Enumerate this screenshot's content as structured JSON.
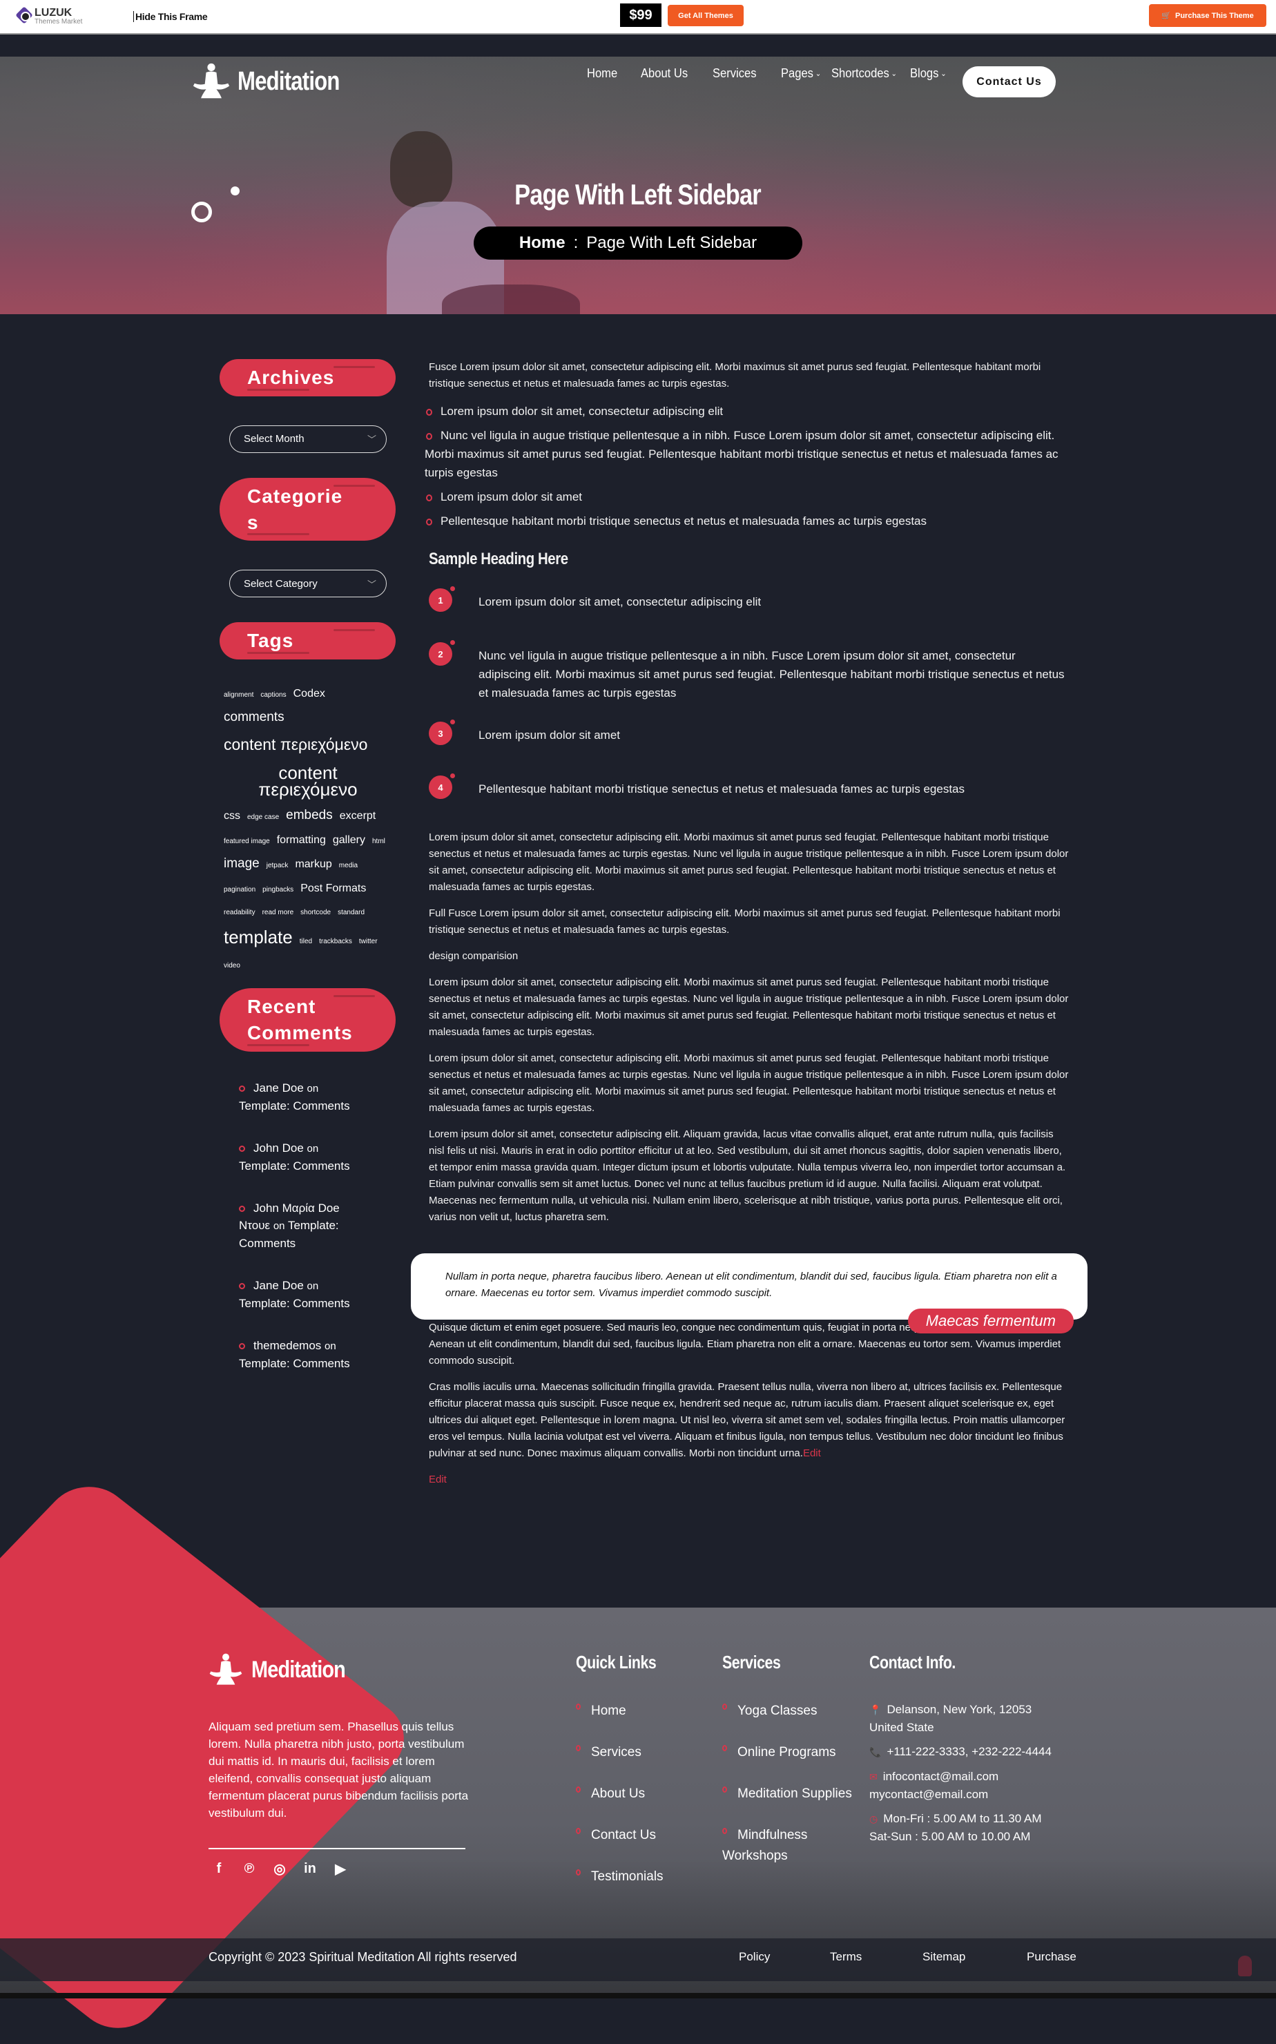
{
  "frame": {
    "brand": "LUZUK",
    "brand_sub": "Themes Market",
    "hide_frame": "Hide This Frame",
    "price": "$99",
    "get_all_themes": "Get All Themes",
    "purchase_theme": "Purchase This Theme"
  },
  "header": {
    "logo_text": "Meditation",
    "nav": [
      {
        "label": "Home",
        "dropdown": false
      },
      {
        "label": "About Us",
        "dropdown": false
      },
      {
        "label": "Services",
        "dropdown": false
      },
      {
        "label": "Pages",
        "dropdown": true
      },
      {
        "label": "Shortcodes",
        "dropdown": true
      },
      {
        "label": "Blogs",
        "dropdown": true
      }
    ],
    "contact_button": "Contact Us"
  },
  "hero": {
    "title": "Page With Left Sidebar",
    "breadcrumb": {
      "home": "Home",
      "separator": ":",
      "current": "Page With Left Sidebar"
    }
  },
  "sidebar": {
    "archives": {
      "title": "Archives",
      "select_value": "Select Month"
    },
    "categories": {
      "title": "Categories",
      "select_value": "Select Category"
    },
    "tags": {
      "title": "Tags",
      "items": [
        {
          "label": "alignment",
          "size": "xs"
        },
        {
          "label": "captions",
          "size": "xs"
        },
        {
          "label": "Codex",
          "size": "m"
        },
        {
          "label": "comments",
          "size": "l"
        },
        {
          "label": "content περιεχόμενο",
          "size": "xl"
        },
        {
          "label": "content περιεχόμενο",
          "size": "xxl"
        },
        {
          "label": "css",
          "size": "m"
        },
        {
          "label": "edge case",
          "size": "xs"
        },
        {
          "label": "embeds",
          "size": "l"
        },
        {
          "label": "excerpt",
          "size": "m"
        },
        {
          "label": "featured image",
          "size": "xs"
        },
        {
          "label": "formatting",
          "size": "m"
        },
        {
          "label": "gallery",
          "size": "m"
        },
        {
          "label": "html",
          "size": "xs"
        },
        {
          "label": "image",
          "size": "l"
        },
        {
          "label": "jetpack",
          "size": "xs"
        },
        {
          "label": "markup",
          "size": "m"
        },
        {
          "label": "media",
          "size": "xs"
        },
        {
          "label": "pagination",
          "size": "xs"
        },
        {
          "label": "pingbacks",
          "size": "xs"
        },
        {
          "label": "Post Formats",
          "size": "m"
        },
        {
          "label": "readability",
          "size": "xs"
        },
        {
          "label": "read more",
          "size": "xs"
        },
        {
          "label": "shortcode",
          "size": "xs"
        },
        {
          "label": "standard",
          "size": "xs"
        },
        {
          "label": "template",
          "size": "xxl"
        },
        {
          "label": "tiled",
          "size": "xs"
        },
        {
          "label": "trackbacks",
          "size": "xs"
        },
        {
          "label": "twitter",
          "size": "xs"
        },
        {
          "label": "video",
          "size": "xs"
        }
      ]
    },
    "recent_comments": {
      "title": "Recent Comments",
      "items": [
        {
          "author": "Jane Doe",
          "on": "on",
          "post": "Template: Comments"
        },
        {
          "author": "John Doe",
          "on": "on",
          "post": "Template: Comments"
        },
        {
          "author": "John Μαρία Doe Ντουε",
          "on": "on",
          "post": "Template: Comments"
        },
        {
          "author": "Jane Doe",
          "on": "on",
          "post": "Template: Comments"
        },
        {
          "author": "themedemos",
          "on": "on",
          "post": "Template: Comments"
        }
      ]
    }
  },
  "main": {
    "intro": "Fusce Lorem ipsum dolor sit amet, consectetur adipiscing elit. Morbi maximus sit amet purus sed feugiat. Pellentesque habitant morbi tristique senectus et netus et malesuada fames ac turpis egestas.",
    "bullets": [
      "Lorem ipsum dolor sit amet, consectetur adipiscing elit",
      "Nunc vel ligula in augue tristique pellentesque a in nibh. Fusce Lorem ipsum dolor sit amet, consectetur adipiscing elit. Morbi maximus sit amet purus sed feugiat. Pellentesque habitant morbi tristique senectus et netus et malesuada fames ac turpis egestas",
      "Lorem ipsum dolor sit amet",
      "Pellentesque habitant morbi tristique senectus et netus et malesuada fames ac turpis egestas"
    ],
    "sample_heading": "Sample Heading Here",
    "numbered": [
      {
        "num": "1",
        "text": "Lorem ipsum dolor sit amet, consectetur adipiscing elit"
      },
      {
        "num": "2",
        "text": "Nunc vel ligula in augue tristique pellentesque a in nibh. Fusce Lorem ipsum dolor sit amet, consectetur adipiscing elit. Morbi maximus sit amet purus sed feugiat. Pellentesque habitant morbi tristique senectus et netus et malesuada fames ac turpis egestas"
      },
      {
        "num": "3",
        "text": "Lorem ipsum dolor sit amet"
      },
      {
        "num": "4",
        "text": "Pellentesque habitant morbi tristique senectus et netus et malesuada fames ac turpis egestas"
      }
    ],
    "paragraphs": [
      "Lorem ipsum dolor sit amet, consectetur adipiscing elit. Morbi maximus sit amet purus sed feugiat. Pellentesque habitant morbi tristique senectus et netus et malesuada fames ac turpis egestas. Nunc vel ligula in augue tristique pellentesque a in nibh. Fusce Lorem ipsum dolor sit amet, consectetur adipiscing elit. Morbi maximus sit amet purus sed feugiat. Pellentesque habitant morbi tristique senectus et netus et malesuada fames ac turpis egestas.",
      "Full Fusce Lorem ipsum dolor sit amet, consectetur adipiscing elit. Morbi maximus sit amet purus sed feugiat. Pellentesque habitant morbi tristique senectus et netus et malesuada fames ac turpis egestas.",
      "design comparision",
      "Lorem ipsum dolor sit amet, consectetur adipiscing elit. Morbi maximus sit amet purus sed feugiat. Pellentesque habitant morbi tristique senectus et netus et malesuada fames ac turpis egestas. Nunc vel ligula in augue tristique pellentesque a in nibh. Fusce Lorem ipsum dolor sit amet, consectetur adipiscing elit. Morbi maximus sit amet purus sed feugiat. Pellentesque habitant morbi tristique senectus et netus et malesuada fames ac turpis egestas.",
      "Lorem ipsum dolor sit amet, consectetur adipiscing elit. Morbi maximus sit amet purus sed feugiat. Pellentesque habitant morbi tristique senectus et netus et malesuada fames ac turpis egestas. Nunc vel ligula in augue tristique pellentesque a in nibh. Fusce Lorem ipsum dolor sit amet, consectetur adipiscing elit. Morbi maximus sit amet purus sed feugiat. Pellentesque habitant morbi tristique senectus et netus et malesuada fames ac turpis egestas.",
      "Lorem ipsum dolor sit amet, consectetur adipiscing elit. Aliquam gravida, lacus vitae convallis aliquet, erat ante rutrum nulla, quis facilisis nisl felis ut nisi. Mauris in erat in odio porttitor efficitur ut at leo. Sed vestibulum, dui sit amet rhoncus sagittis, dolor sapien venenatis libero, et tempor enim massa gravida quam. Integer dictum ipsum et lobortis vulputate. Nulla tempus viverra leo, non imperdiet tortor accumsan a. Etiam pulvinar convallis sem sit amet luctus. Donec vel nunc at tellus faucibus pretium id id augue. Nulla facilisi. Aliquam erat volutpat. Maecenas nec fermentum nulla, ut vehicula nisi. Nullam enim libero, scelerisque at nibh tristique, varius porta purus. Pellentesque elit orci, varius non velit ut, luctus pharetra sem."
    ],
    "quote": {
      "text": "Nullam in porta neque, pharetra faucibus libero. Aenean ut elit condimentum, blandit dui sed, faucibus ligula. Etiam pharetra non elit a ornare. Maecenas eu tortor sem. Vivamus imperdiet commodo suscipit.",
      "cite": "Maecas fermentum"
    },
    "after_quote": "Quisque dictum et enim eget posuere. Sed mauris leo, congue nec condimentum quis, feugiat in porta neque, pharetra faucibus libero. Aenean ut elit condimentum, blandit dui sed, faucibus ligula. Etiam pharetra non elit a ornare. Maecenas eu tortor sem. Vivamus imperdiet commodo suscipit.",
    "last_paragraph": "Cras mollis iaculis urna. Maecenas sollicitudin fringilla gravida. Praesent tellus nulla, viverra non libero at, ultrices facilisis ex. Pellentesque efficitur placerat massa quis suscipit. Fusce neque ex, hendrerit sed neque ac, rutrum iaculis diam. Praesent aliquet scelerisque ex, eget ultrices dui aliquet eget. Pellentesque in lorem magna. Ut nisl leo, viverra sit amet sem vel, sodales fringilla lectus. Proin mattis ullamcorper eros vel tempus. Nulla lacinia volutpat est vel viverra. Aliquam et finibus ligula, non tempus tellus. Vestibulum nec dolor tincidunt leo finibus pulvinar at sed nunc. Donec maximus aliquam convallis. Morbi non tincidunt urna.",
    "inline_edit": "Edit",
    "edit": "Edit"
  },
  "footer": {
    "logo_text": "Meditation",
    "about": "Aliquam sed pretium sem. Phasellus quis tellus lorem. Nulla pharetra nibh justo, porta vestibulum dui mattis id. In mauris dui, facilisis et lorem eleifend, convallis consequat justo aliquam fermentum placerat purus bibendum facilisis porta vestibulum dui.",
    "social": [
      {
        "name": "facebook",
        "glyph": "f"
      },
      {
        "name": "pinterest",
        "glyph": "℗"
      },
      {
        "name": "instagram",
        "glyph": "◎"
      },
      {
        "name": "linkedin",
        "glyph": "in"
      },
      {
        "name": "youtube",
        "glyph": "▶"
      }
    ],
    "quick_links": {
      "title": "Quick Links",
      "items": [
        "Home",
        "Services",
        "About Us",
        "Contact Us",
        "Testimonials"
      ]
    },
    "services": {
      "title": "Services",
      "items": [
        "Yoga Classes",
        "Online Programs",
        "Meditation Supplies",
        "Mindfulness Workshops"
      ]
    },
    "contact": {
      "title": "Contact Info.",
      "address": "Delanson, New York, 12053 United State",
      "phone": "+111-222-3333, +232-222-4444",
      "email": "infocontact@mail.com mycontact@email.com",
      "hours": "Mon-Fri : 5.00 AM to 11.30 AM Sat-Sun : 5.00 AM to 10.00 AM"
    },
    "copyright": "Copyright © 2023 Spiritual Meditation All rights reserved",
    "bottom_links": [
      "Policy",
      "Terms",
      "Sitemap",
      "Purchase"
    ]
  },
  "colors": {
    "accent": "#d9364b",
    "frame_orange": "#f05a22",
    "background": "#1d202b"
  }
}
